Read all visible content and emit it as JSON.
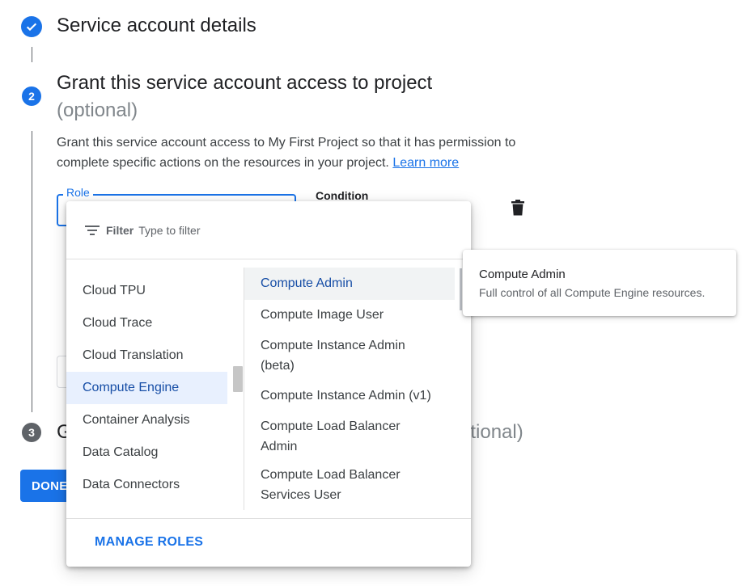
{
  "steps": [
    {
      "number": "",
      "title": "Service account details",
      "status": "done"
    },
    {
      "number": "2",
      "title": "Grant this service account access to project",
      "optional_label": "(optional)",
      "status": "active"
    },
    {
      "number": "3",
      "title_visible": "G",
      "title_tail_visible": "otional)",
      "status": "inactive"
    }
  ],
  "description": {
    "text": "Grant this service account access to My First Project so that it has permission to complete specific actions on the resources in your project.",
    "link": "Learn more"
  },
  "role_field": {
    "label": "Role"
  },
  "condition_label": "Condition",
  "done_button": {
    "label": "DONE"
  },
  "dropdown": {
    "filter": {
      "label": "Filter",
      "placeholder": "Type to filter"
    },
    "services": [
      {
        "label": "Cloud TPU"
      },
      {
        "label": "Cloud Trace"
      },
      {
        "label": "Cloud Translation"
      },
      {
        "label": "Compute Engine",
        "selected": true
      },
      {
        "label": "Container Analysis"
      },
      {
        "label": "Data Catalog"
      },
      {
        "label": "Data Connectors"
      }
    ],
    "roles": [
      {
        "label": "Compute Admin",
        "highlighted": true
      },
      {
        "label": "Compute Image User"
      },
      {
        "label": "Compute Instance Admin (beta)"
      },
      {
        "label": "Compute Instance Admin (v1)"
      },
      {
        "label": "Compute Load Balancer Admin"
      },
      {
        "label": "Compute Load Balancer Services User"
      }
    ],
    "manage_roles": "MANAGE ROLES"
  },
  "tooltip": {
    "title": "Compute Admin",
    "description": "Full control of all Compute Engine resources."
  },
  "colors": {
    "accent": "#1a73e8",
    "selected_bg": "#e8f0fe",
    "selected_text": "#174ea6",
    "inactive_step": "#5f6368"
  },
  "icons": {
    "step_done": "check-icon",
    "filter": "filter-icon",
    "delete": "trash-icon"
  }
}
